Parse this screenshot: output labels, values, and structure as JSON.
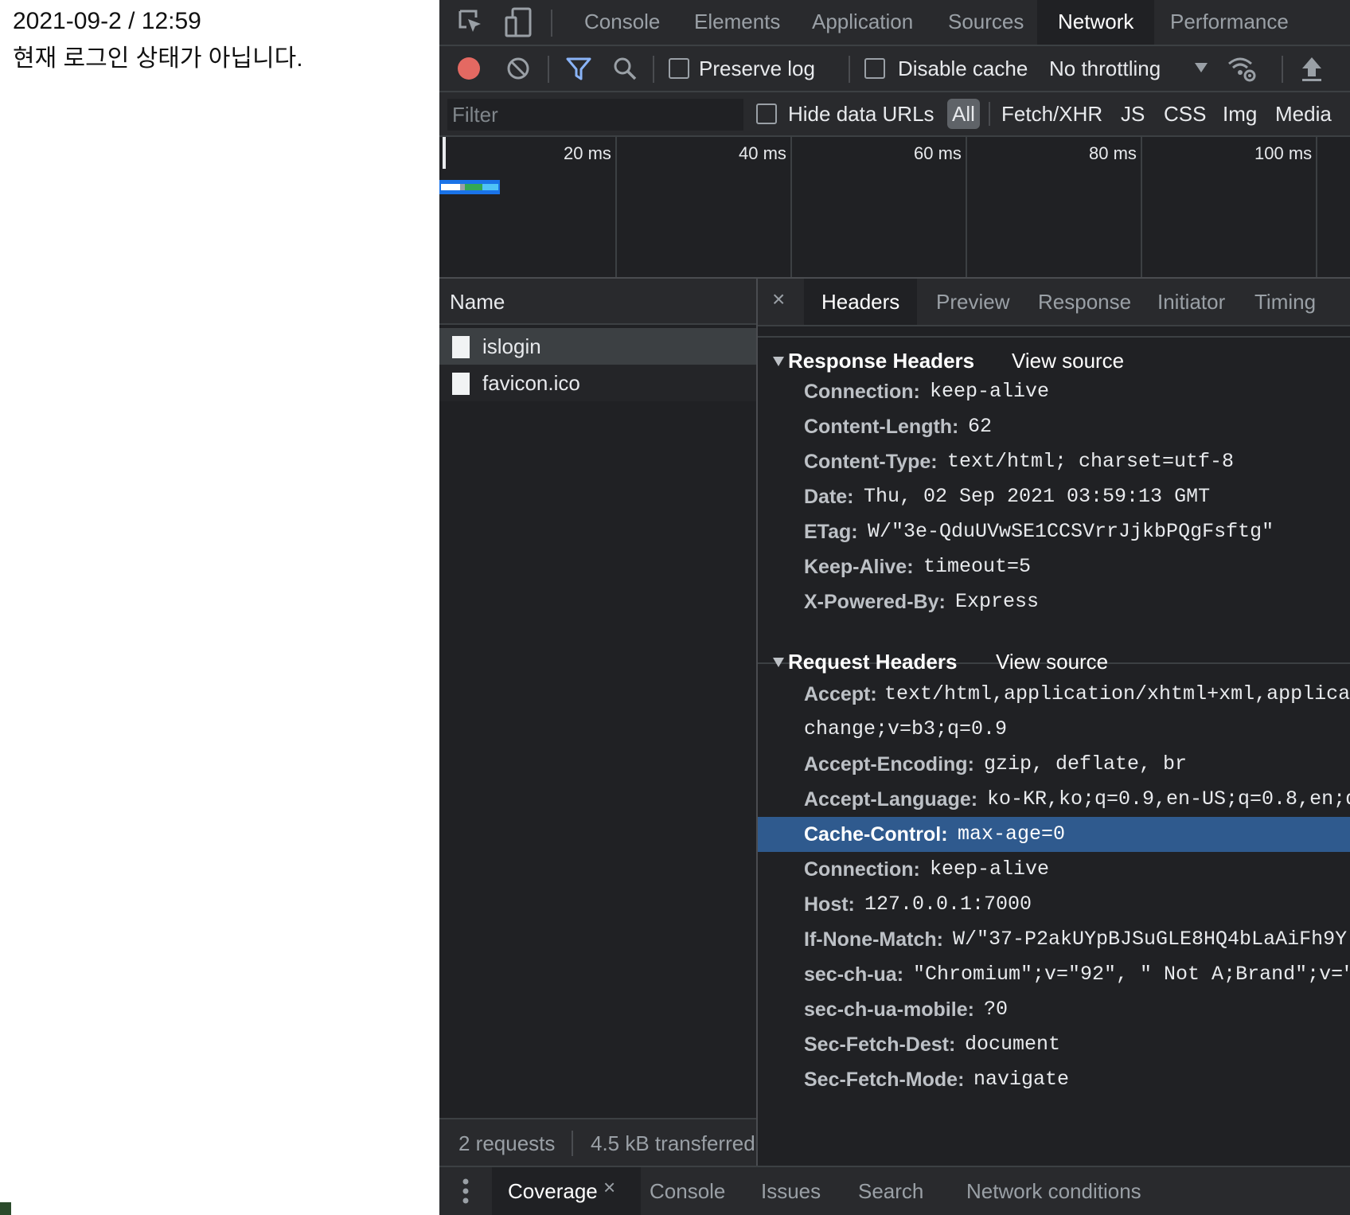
{
  "page": {
    "datetime": "2021-09-2 / 12:59",
    "message": "현재 로그인 상태가 아닙니다."
  },
  "devtools": {
    "main_tabs": [
      "Console",
      "Elements",
      "Application",
      "Sources",
      "Network",
      "Performance"
    ],
    "active_main_tab": "Network",
    "toolbar": {
      "preserve_log": "Preserve log",
      "disable_cache": "Disable cache",
      "throttling": "No throttling"
    },
    "filter": {
      "placeholder": "Filter",
      "hide_data_urls": "Hide data URLs",
      "types": [
        "All",
        "Fetch/XHR",
        "JS",
        "CSS",
        "Img",
        "Media"
      ]
    },
    "timeline": {
      "ticks": [
        "20 ms",
        "40 ms",
        "60 ms",
        "80 ms",
        "100 ms"
      ]
    },
    "name_pane": {
      "header": "Name",
      "requests": [
        {
          "name": "islogin",
          "selected": true
        },
        {
          "name": "favicon.ico",
          "selected": false
        }
      ],
      "status_requests": "2 requests",
      "status_transferred": "4.5 kB transferred"
    },
    "detail_tabs": [
      "Headers",
      "Preview",
      "Response",
      "Initiator",
      "Timing"
    ],
    "close_glyph": "×",
    "response_headers": {
      "title": "Response Headers",
      "view_source": "View source",
      "rows": [
        {
          "k": "Connection:",
          "v": "keep-alive"
        },
        {
          "k": "Content-Length:",
          "v": "62"
        },
        {
          "k": "Content-Type:",
          "v": "text/html; charset=utf-8"
        },
        {
          "k": "Date:",
          "v": "Thu, 02 Sep 2021 03:59:13 GMT"
        },
        {
          "k": "ETag:",
          "v": "W/\"3e-QduUVwSE1CCSVrrJjkbPQgFsftg\""
        },
        {
          "k": "Keep-Alive:",
          "v": "timeout=5"
        },
        {
          "k": "X-Powered-By:",
          "v": "Express"
        }
      ]
    },
    "request_headers": {
      "title": "Request Headers",
      "view_source": "View source",
      "accept_key": "Accept:",
      "accept_value": "text/html,application/xhtml+xml,applicat",
      "accept_cont": "change;v=b3;q=0.9",
      "rows": [
        {
          "k": "Accept-Encoding:",
          "v": "gzip, deflate, br"
        },
        {
          "k": "Accept-Language:",
          "v": "ko-KR,ko;q=0.9,en-US;q=0.8,en;q"
        },
        {
          "k": "Cache-Control:",
          "v": "max-age=0",
          "selected": true
        },
        {
          "k": "Connection:",
          "v": "keep-alive"
        },
        {
          "k": "Host:",
          "v": "127.0.0.1:7000"
        },
        {
          "k": "If-None-Match:",
          "v": "W/\"37-P2akUYpBJSuGLE8HQ4bLaAiFh9Y"
        },
        {
          "k": "sec-ch-ua:",
          "v": "\"Chromium\";v=\"92\", \" Not A;Brand\";v=\""
        },
        {
          "k": "sec-ch-ua-mobile:",
          "v": "?0"
        },
        {
          "k": "Sec-Fetch-Dest:",
          "v": "document"
        },
        {
          "k": "Sec-Fetch-Mode:",
          "v": "navigate"
        }
      ]
    },
    "drawer": {
      "tabs": [
        "Coverage",
        "Console",
        "Issues",
        "Search",
        "Network conditions"
      ],
      "active": "Coverage"
    },
    "colors": {
      "record": "#e46962",
      "filter_icon": "#8ab4f8",
      "selection": "#2f5a8e"
    }
  }
}
